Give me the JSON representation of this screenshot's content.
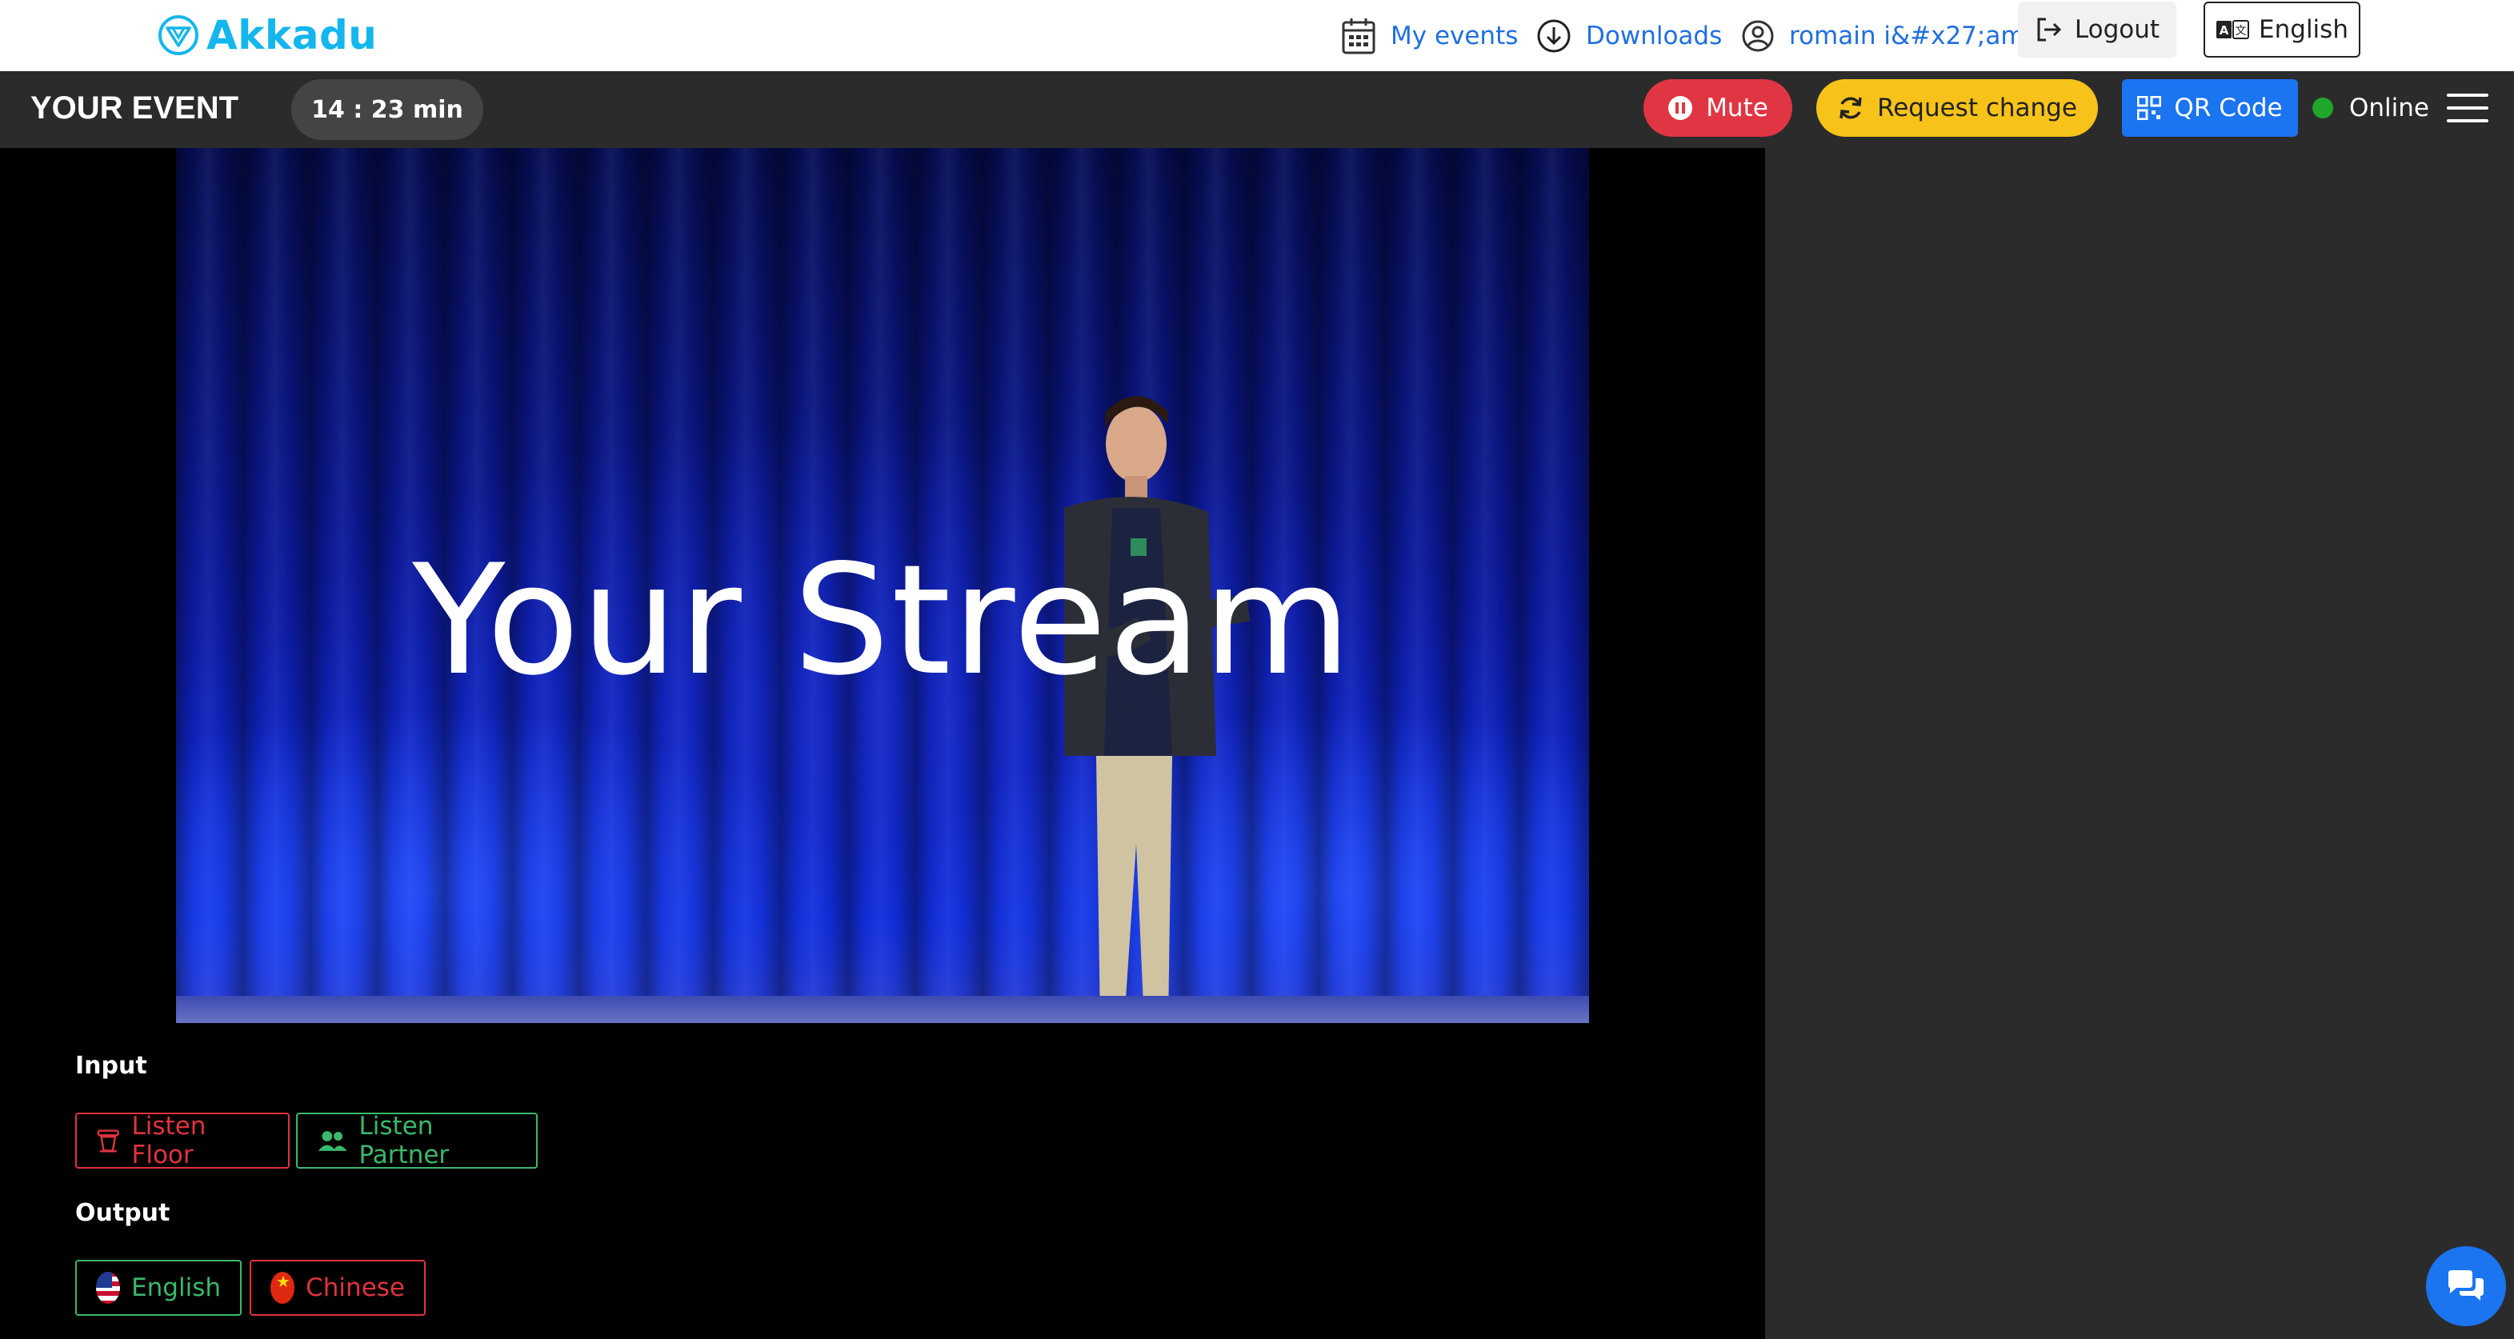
{
  "nav": {
    "brand": "Akkadu",
    "my_events": "My events",
    "downloads": "Downloads",
    "user": "romain i&#x27;am",
    "logout": "Logout",
    "language": "English"
  },
  "event": {
    "title": "YOUR EVENT",
    "timer": "14 : 23 min",
    "mute": "Mute",
    "request_change": "Request change",
    "qr_code": "QR Code",
    "status": "Online"
  },
  "stream": {
    "caption": "Your Stream"
  },
  "input": {
    "label": "Input",
    "options": [
      "Listen Floor",
      "Listen Partner"
    ]
  },
  "output": {
    "label": "Output",
    "options": [
      "English",
      "Chinese"
    ]
  },
  "colors": {
    "brand": "#14b6ee",
    "link": "#1f6fe0",
    "mute": "#e03542",
    "request": "#f7c31a",
    "qr": "#1b74f0",
    "online": "#1fa62b",
    "red_chip": "#e0333f",
    "green_chip": "#39b86b"
  }
}
